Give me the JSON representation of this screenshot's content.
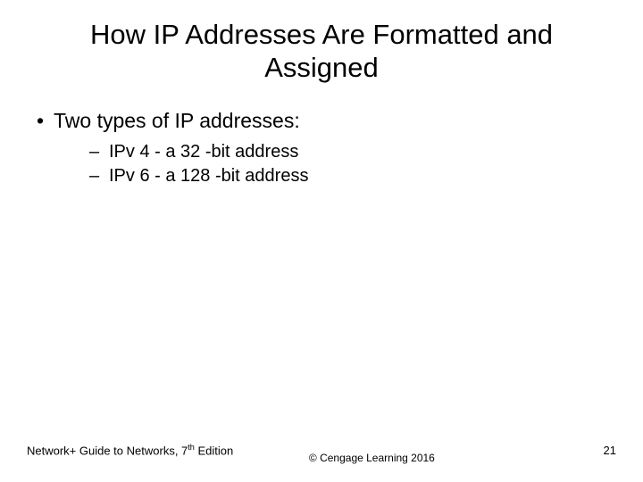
{
  "title": "How IP Addresses Are Formatted and Assigned",
  "bullets": {
    "l1": "Two types of IP addresses:",
    "l2a": "IPv 4 - a 32 -bit address",
    "l2b": "IPv 6 - a 128 -bit address"
  },
  "footer": {
    "left_pre": "Network+ Guide to Networks, 7",
    "left_sup": "th",
    "left_post": " Edition",
    "center": "© Cengage Learning  2016",
    "right": "21"
  }
}
